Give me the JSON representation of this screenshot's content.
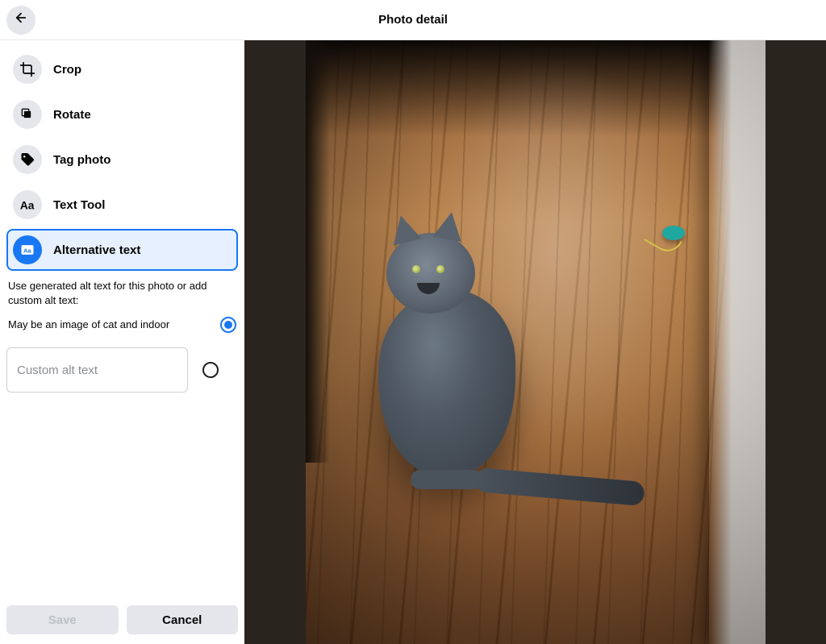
{
  "header": {
    "title": "Photo detail"
  },
  "tools": {
    "crop": "Crop",
    "rotate": "Rotate",
    "tag": "Tag photo",
    "text_tool": "Text Tool",
    "alt_text": "Alternative text"
  },
  "alt_panel": {
    "description": "Use generated alt text for this photo or add custom alt text:",
    "generated": "May be an image of cat and indoor",
    "custom_placeholder": "Custom alt text",
    "custom_value": ""
  },
  "buttons": {
    "save": "Save",
    "cancel": "Cancel"
  }
}
